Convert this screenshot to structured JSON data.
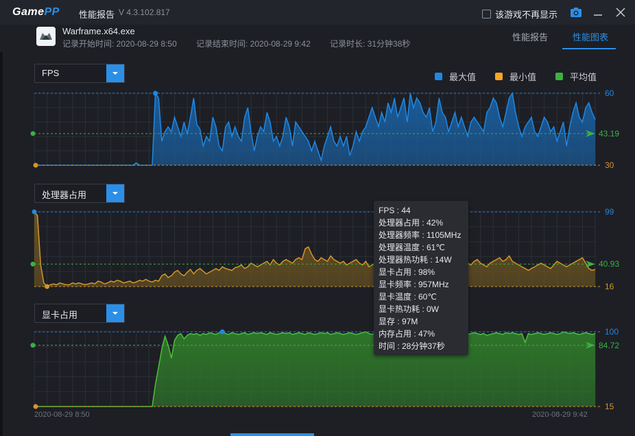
{
  "titlebar": {
    "logo_main": "Game",
    "logo_accent": "PP",
    "title": "性能报告",
    "version": "V 4.3.102.817",
    "hide_game_label": "该游戏不再显示"
  },
  "info": {
    "exe": "Warframe.x64.exe",
    "start": "记录开始时间: 2020-08-29 8:50",
    "end": "记录结束时间: 2020-08-29 9:42",
    "duration": "记录时长: 31分钟38秒"
  },
  "tabs": [
    {
      "label": "性能报告",
      "active": false
    },
    {
      "label": "性能图表",
      "active": true
    }
  ],
  "legend": [
    {
      "label": "最大值",
      "color": "#1e88e5"
    },
    {
      "label": "最小值",
      "color": "#f5a623"
    },
    {
      "label": "平均值",
      "color": "#3cb043"
    }
  ],
  "charts": {
    "fps": {
      "select_label": "FPS",
      "max": "60",
      "avg": "43.19",
      "min": "30"
    },
    "cpu": {
      "select_label": "处理器占用",
      "max": "99",
      "avg": "40.93",
      "min": "16"
    },
    "gpu": {
      "select_label": "显卡占用",
      "max": "100",
      "avg": "84.72",
      "min": "15"
    }
  },
  "dates": {
    "start": "2020-08-29 8:50",
    "end": "2020-08-29 9:42"
  },
  "tooltip": [
    "FPS : 44",
    "处理器占用 : 42%",
    "处理器频率 : 1105MHz",
    "处理器温度 : 61℃",
    "处理器热功耗 : 14W",
    "显卡占用 : 98%",
    "显卡频率 : 957MHz",
    "显卡温度 : 60℃",
    "显卡热功耗 : 0W",
    "显存 : 97M",
    "内存占用 : 47%",
    "时间 : 28分钟37秒"
  ],
  "chart_data": [
    {
      "type": "area",
      "title": "FPS",
      "series": [
        {
          "name": "FPS",
          "values": [
            30,
            30,
            30,
            30,
            30,
            30,
            30,
            30,
            30,
            30,
            30,
            30,
            30,
            30,
            30,
            30,
            30,
            30,
            30,
            30,
            30,
            30,
            30,
            30,
            30,
            30,
            30,
            30,
            30,
            30,
            30,
            30,
            31,
            30,
            30,
            30,
            30,
            30,
            60,
            58,
            40,
            44,
            46,
            44,
            50,
            46,
            42,
            48,
            43,
            50,
            58,
            47,
            45,
            38,
            42,
            40,
            50,
            46,
            38,
            36,
            46,
            48,
            42,
            46,
            42,
            40,
            50,
            54,
            44,
            36,
            42,
            46,
            44,
            52,
            48,
            40,
            42,
            38,
            42,
            50,
            46,
            38,
            48,
            46,
            44,
            42,
            40,
            36,
            40,
            36,
            32,
            38,
            42,
            46,
            40,
            38,
            42,
            38,
            42,
            34,
            38,
            44,
            40,
            44,
            46,
            50,
            54,
            50,
            46,
            52,
            48,
            56,
            52,
            58,
            50,
            54,
            58,
            48,
            60,
            54,
            58,
            56,
            52,
            50,
            54,
            44,
            48,
            58,
            52,
            50,
            44,
            48,
            52,
            46,
            50,
            46,
            42,
            48,
            50,
            48,
            46,
            44,
            52,
            54,
            58,
            56,
            50,
            46,
            52,
            58,
            60,
            52,
            46,
            42,
            46,
            48,
            50,
            44,
            42,
            46,
            50,
            48,
            44,
            46,
            40,
            44,
            48,
            38,
            46,
            52,
            56,
            50,
            48,
            54,
            56,
            52,
            49
          ]
        }
      ],
      "ylim": [
        30,
        60
      ],
      "stats": {
        "max": 60,
        "avg": 43.19,
        "min": 30
      }
    },
    {
      "type": "area",
      "title": "处理器占用",
      "series": [
        {
          "name": "处理器占用",
          "values": [
            99,
            95,
            40,
            20,
            16,
            18,
            19,
            18,
            20,
            19,
            18,
            18,
            20,
            19,
            20,
            19,
            18,
            19,
            20,
            19,
            22,
            21,
            19,
            20,
            22,
            21,
            23,
            22,
            20,
            21,
            22,
            20,
            21,
            23,
            22,
            24,
            22,
            21,
            23,
            22,
            28,
            30,
            26,
            28,
            32,
            34,
            30,
            28,
            32,
            35,
            30,
            34,
            36,
            33,
            30,
            32,
            34,
            36,
            34,
            38,
            36,
            35,
            34,
            37,
            38,
            40,
            36,
            38,
            42,
            40,
            38,
            40,
            42,
            44,
            40,
            46,
            42,
            40,
            44,
            46,
            44,
            42,
            46,
            48,
            46,
            58,
            60,
            52,
            46,
            44,
            48,
            46,
            44,
            50,
            46,
            44,
            42,
            44,
            40,
            42,
            44,
            46,
            42,
            40,
            44,
            38,
            40,
            42,
            40,
            38,
            42,
            40,
            44,
            46,
            38,
            40,
            36,
            44,
            42,
            40,
            38,
            42,
            44,
            40,
            38,
            42,
            40,
            44,
            42,
            46,
            44,
            40,
            42,
            38,
            36,
            40,
            42,
            40,
            44,
            46,
            42,
            40,
            38,
            42,
            44,
            46,
            48,
            44,
            46,
            50,
            44,
            42,
            40,
            38,
            36,
            34,
            36,
            38,
            40,
            42,
            40,
            38,
            36,
            40,
            44,
            42,
            40,
            38,
            40,
            42,
            44,
            46,
            48,
            42,
            36,
            34,
            35
          ]
        }
      ],
      "ylim": [
        16,
        99
      ],
      "stats": {
        "max": 99,
        "avg": 40.93,
        "min": 16
      }
    },
    {
      "type": "area",
      "title": "显卡占用",
      "series": [
        {
          "name": "显卡占用",
          "values": [
            15,
            15,
            15,
            15,
            15,
            15,
            15,
            15,
            15,
            15,
            15,
            15,
            15,
            15,
            15,
            15,
            15,
            15,
            15,
            15,
            15,
            15,
            15,
            15,
            15,
            15,
            15,
            15,
            15,
            15,
            15,
            15,
            15,
            15,
            15,
            15,
            15,
            15,
            40,
            60,
            80,
            95,
            85,
            70,
            90,
            96,
            98,
            92,
            96,
            98,
            97,
            98,
            96,
            98,
            97,
            99,
            98,
            97,
            99,
            100,
            98,
            97,
            99,
            98,
            97,
            98,
            99,
            97,
            98,
            99,
            98,
            99,
            98,
            97,
            99,
            98,
            97,
            98,
            99,
            98,
            99,
            97,
            98,
            99,
            98,
            97,
            99,
            98,
            97,
            98,
            99,
            98,
            99,
            97,
            98,
            99,
            98,
            97,
            98,
            99,
            98,
            97,
            98,
            99,
            100,
            98,
            97,
            99,
            98,
            97,
            98,
            99,
            98,
            97,
            99,
            98,
            97,
            98,
            99,
            98,
            97,
            98,
            99,
            100,
            99,
            98,
            97,
            99,
            98,
            97,
            98,
            99,
            97,
            98,
            99,
            98,
            97,
            98,
            99,
            98,
            97,
            98,
            96,
            97,
            98,
            99,
            98,
            97,
            99,
            98,
            99,
            98,
            97,
            98,
            88,
            98,
            97,
            98,
            99,
            98,
            97,
            98,
            99,
            98,
            97,
            98,
            100,
            99,
            98,
            99,
            98,
            97,
            98,
            99,
            98,
            97,
            98
          ]
        }
      ],
      "ylim": [
        15,
        100
      ],
      "stats": {
        "max": 100,
        "avg": 84.72,
        "min": 15
      }
    }
  ]
}
